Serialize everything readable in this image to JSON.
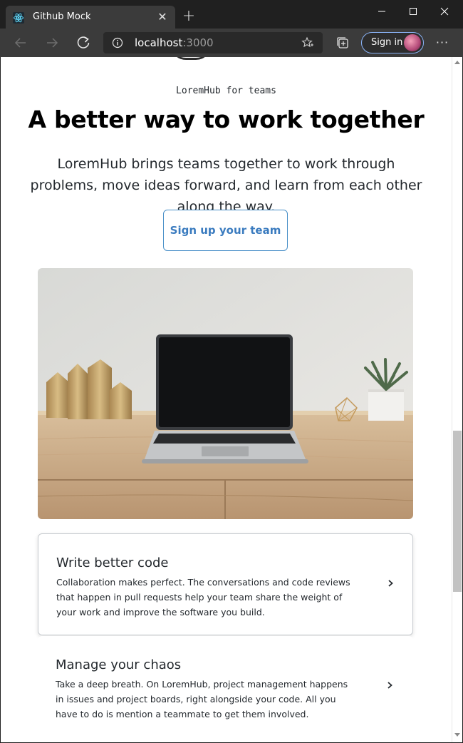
{
  "browser": {
    "tab_title": "Github Mock",
    "url_host": "localhost",
    "url_port": ":3000",
    "signin_label": "Sign in",
    "accent_color": "#8ab4f8"
  },
  "page": {
    "eyebrow": "LoremHub for teams",
    "headline": "A better way to work together",
    "lead": "LoremHub brings teams together to work through problems, move ideas forward, and learn from each other along the way.",
    "cta_label": "Sign up your team",
    "cta_color": "#3a7bbf",
    "features": [
      {
        "title": "Write better code",
        "description": "Collaboration makes perfect. The conversations and code reviews that happen in pull requests help your team share the weight of your work and improve the software you build.",
        "selected": true
      },
      {
        "title": "Manage your chaos",
        "description": "Take a deep breath. On LoremHub, project management happens in issues and project boards, right alongside your code. All you have to do is mention a teammate to get them involved.",
        "selected": false
      }
    ]
  },
  "icons": {
    "favicon": "react-icon",
    "back": "arrow-left-icon",
    "forward": "arrow-right-icon",
    "reload": "reload-icon",
    "info": "info-icon",
    "favorite": "star-icon",
    "collections": "collections-icon",
    "more": "more-horizontal-icon",
    "chevron": "chevron-right-icon"
  }
}
